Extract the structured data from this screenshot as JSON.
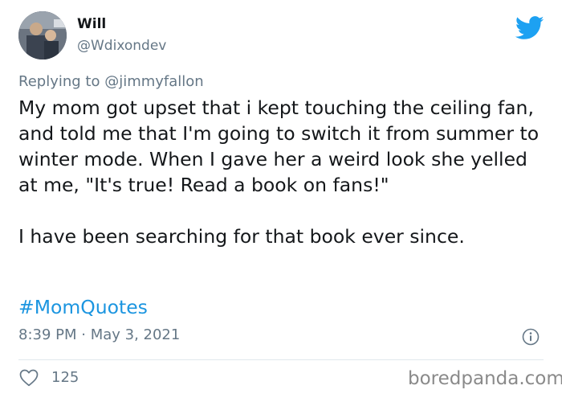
{
  "author": {
    "display_name": "Will",
    "handle": "@Wdixondev"
  },
  "reply": {
    "prefix": "Replying to ",
    "mention": "@jimmyfallon"
  },
  "tweet": {
    "paragraph_1": "My mom got upset that i kept touching the ceiling fan, and told me that I'm going to switch it from summer to winter mode. When I gave her a weird look she yelled at me, \"It's true! Read a book on fans!\"",
    "paragraph_2": "I have been searching for that book ever since.",
    "hashtag": "#MomQuotes"
  },
  "meta": {
    "timestamp": "8:39 PM · May 3, 2021",
    "likes": "125"
  },
  "watermark": "boredpanda.com",
  "icons": {
    "brand": "twitter-bird-icon",
    "info": "info-icon",
    "like": "heart-icon"
  },
  "colors": {
    "twitter_blue": "#1da1f2",
    "link_blue": "#1b95e0",
    "secondary_text": "#657786",
    "divider": "#e1e8ed"
  }
}
